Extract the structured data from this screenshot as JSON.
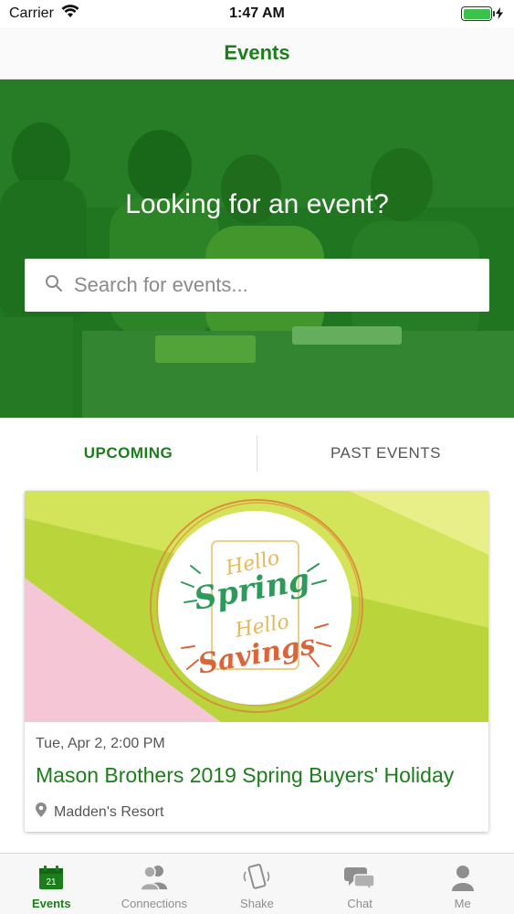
{
  "status_bar": {
    "carrier": "Carrier",
    "time": "1:47 AM",
    "battery_level": 1.0
  },
  "nav": {
    "title": "Events"
  },
  "hero": {
    "heading": "Looking for an event?",
    "search_placeholder": "Search for events..."
  },
  "tabs": {
    "upcoming": "UPCOMING",
    "past": "PAST EVENTS",
    "active": "upcoming"
  },
  "event": {
    "banner_text": [
      "Hello",
      "Spring",
      "Hello",
      "Savings"
    ],
    "date": "Tue, Apr 2, 2:00 PM",
    "title": "Mason Brothers 2019 Spring Buyers' Holiday",
    "location": "Madden's Resort"
  },
  "tab_bar": {
    "items": [
      {
        "label": "Events",
        "icon": "calendar-icon",
        "calendar_day": "21",
        "active": true
      },
      {
        "label": "Connections",
        "icon": "people-icon",
        "active": false
      },
      {
        "label": "Shake",
        "icon": "shake-phone-icon",
        "active": false
      },
      {
        "label": "Chat",
        "icon": "chat-bubbles-icon",
        "active": false
      },
      {
        "label": "Me",
        "icon": "person-icon",
        "active": false
      }
    ]
  },
  "colors": {
    "brand_green": "#1b7e1b",
    "hero_tint": "#148c14",
    "inactive_gray": "#8e8e8e"
  }
}
